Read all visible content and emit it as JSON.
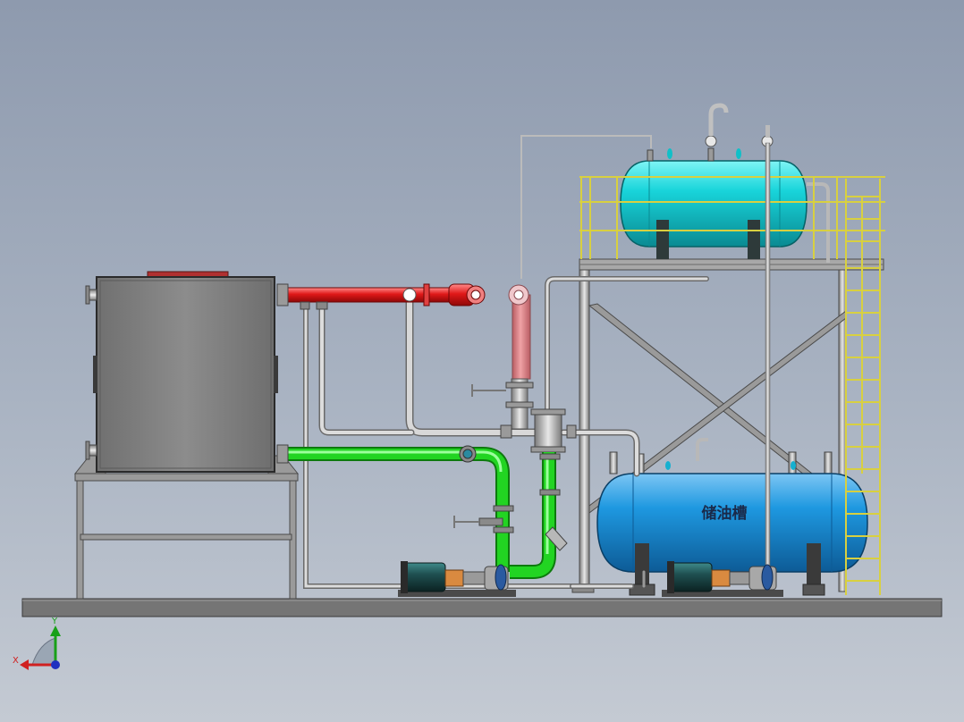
{
  "storage_tank": {
    "label": "储油槽"
  },
  "axis_triad": {
    "x_label": "X",
    "y_label": "Y"
  },
  "colors": {
    "hot_pipe": "#e01818",
    "hot_pipe_pink": "#d97a80",
    "cold_pipe": "#22d422",
    "expansion_tank": "#16d0d6",
    "storage_tank": "#1e9ae0",
    "ladder": "#e8e84a",
    "steel": "#a6a6a6"
  }
}
